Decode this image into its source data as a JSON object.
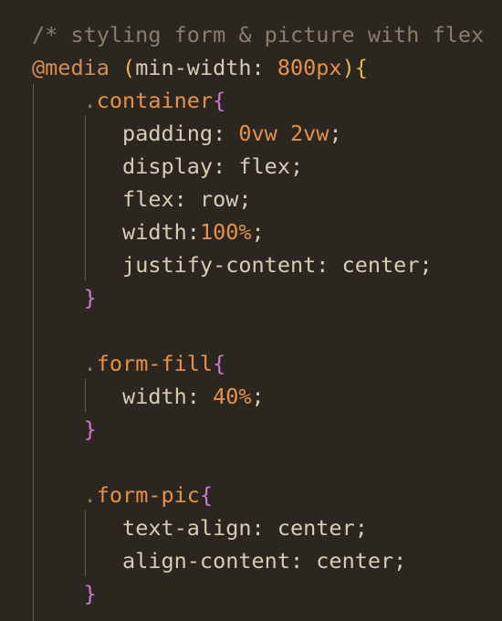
{
  "colors": {
    "background": "#2b2620",
    "comment": "#8a7d69",
    "at_rule": "#d98c53",
    "paren": "#e6b84a",
    "brace_outer": "#e6b84a",
    "brace_inner": "#c97bd4",
    "selector": "#e6914a",
    "selector_dot": "#8a7d69",
    "property": "#d9ccb4",
    "value": "#d9ccb4",
    "number": "#e6914a",
    "unit": "#e6914a",
    "guide": "#6a5f4d"
  },
  "code": {
    "lines": [
      {
        "tokens": [
          {
            "t": "/* styling form & picture with flex",
            "k": "comment"
          }
        ]
      },
      {
        "tokens": [
          {
            "t": "@media",
            "k": "at_rule"
          },
          {
            "t": " ",
            "k": "value"
          },
          {
            "t": "(",
            "k": "paren"
          },
          {
            "t": "min-width",
            "k": "property"
          },
          {
            "t": ": ",
            "k": "value"
          },
          {
            "t": "800px",
            "k": "number"
          },
          {
            "t": ")",
            "k": "paren"
          },
          {
            "t": "{",
            "k": "brace_outer"
          }
        ]
      },
      {
        "tokens": [
          {
            "t": "    ",
            "k": "value"
          },
          {
            "t": ".",
            "k": "selector_dot"
          },
          {
            "t": "container",
            "k": "selector"
          },
          {
            "t": "{",
            "k": "brace_inner"
          }
        ]
      },
      {
        "tokens": [
          {
            "t": "       ",
            "k": "value"
          },
          {
            "t": "padding",
            "k": "property"
          },
          {
            "t": ": ",
            "k": "value"
          },
          {
            "t": "0vw 2vw",
            "k": "number"
          },
          {
            "t": ";",
            "k": "value"
          }
        ]
      },
      {
        "tokens": [
          {
            "t": "       ",
            "k": "value"
          },
          {
            "t": "display",
            "k": "property"
          },
          {
            "t": ": ",
            "k": "value"
          },
          {
            "t": "flex",
            "k": "value"
          },
          {
            "t": ";",
            "k": "value"
          }
        ]
      },
      {
        "tokens": [
          {
            "t": "       ",
            "k": "value"
          },
          {
            "t": "flex",
            "k": "property"
          },
          {
            "t": ": ",
            "k": "value"
          },
          {
            "t": "row",
            "k": "value"
          },
          {
            "t": ";",
            "k": "value"
          }
        ]
      },
      {
        "tokens": [
          {
            "t": "       ",
            "k": "value"
          },
          {
            "t": "width",
            "k": "property"
          },
          {
            "t": ":",
            "k": "value"
          },
          {
            "t": "100%",
            "k": "number"
          },
          {
            "t": ";",
            "k": "value"
          }
        ]
      },
      {
        "tokens": [
          {
            "t": "       ",
            "k": "value"
          },
          {
            "t": "justify-content",
            "k": "property"
          },
          {
            "t": ": ",
            "k": "value"
          },
          {
            "t": "center",
            "k": "value"
          },
          {
            "t": ";",
            "k": "value"
          }
        ]
      },
      {
        "tokens": [
          {
            "t": "    ",
            "k": "value"
          },
          {
            "t": "}",
            "k": "brace_inner"
          }
        ]
      },
      {
        "tokens": []
      },
      {
        "tokens": [
          {
            "t": "    ",
            "k": "value"
          },
          {
            "t": ".",
            "k": "selector_dot"
          },
          {
            "t": "form-fill",
            "k": "selector"
          },
          {
            "t": "{",
            "k": "brace_inner"
          }
        ]
      },
      {
        "tokens": [
          {
            "t": "       ",
            "k": "value"
          },
          {
            "t": "width",
            "k": "property"
          },
          {
            "t": ": ",
            "k": "value"
          },
          {
            "t": "40%",
            "k": "number"
          },
          {
            "t": ";",
            "k": "value"
          }
        ]
      },
      {
        "tokens": [
          {
            "t": "    ",
            "k": "value"
          },
          {
            "t": "}",
            "k": "brace_inner"
          }
        ]
      },
      {
        "tokens": []
      },
      {
        "tokens": [
          {
            "t": "    ",
            "k": "value"
          },
          {
            "t": ".",
            "k": "selector_dot"
          },
          {
            "t": "form-pic",
            "k": "selector"
          },
          {
            "t": "{",
            "k": "brace_inner"
          }
        ]
      },
      {
        "tokens": [
          {
            "t": "       ",
            "k": "value"
          },
          {
            "t": "text-align",
            "k": "property"
          },
          {
            "t": ": ",
            "k": "value"
          },
          {
            "t": "center",
            "k": "value"
          },
          {
            "t": ";",
            "k": "value"
          }
        ]
      },
      {
        "tokens": [
          {
            "t": "       ",
            "k": "value"
          },
          {
            "t": "align-content",
            "k": "property"
          },
          {
            "t": ": ",
            "k": "value"
          },
          {
            "t": "center",
            "k": "value"
          },
          {
            "t": ";",
            "k": "value"
          }
        ]
      },
      {
        "tokens": [
          {
            "t": "    ",
            "k": "value"
          },
          {
            "t": "}",
            "k": "brace_inner"
          }
        ]
      },
      {
        "tokens": []
      }
    ]
  }
}
